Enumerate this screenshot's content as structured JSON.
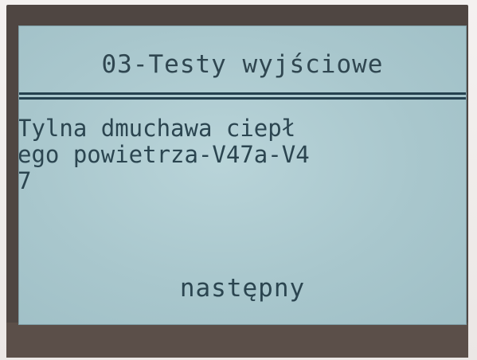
{
  "screen": {
    "title": "03-Testy wyjściowe",
    "message_lines": [
      " Tylna dmuchawa ciepł",
      "ego powietrza-V47a-V4",
      "7"
    ],
    "next_label": "następny"
  }
}
